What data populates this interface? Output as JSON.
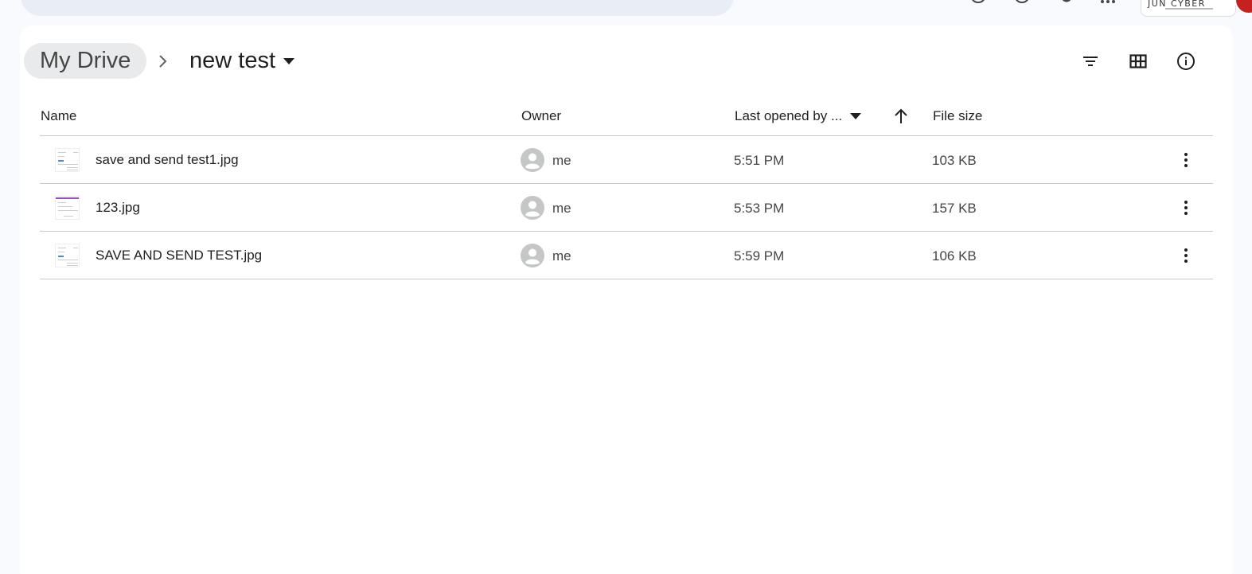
{
  "account": {
    "brand": "JUN CYBER"
  },
  "breadcrumb": {
    "root": "My Drive",
    "current": "new test"
  },
  "columns": {
    "name": "Name",
    "owner": "Owner",
    "last_opened": "Last opened by ...",
    "file_size": "File size"
  },
  "files": [
    {
      "name": "save and send test1.jpg",
      "owner": "me",
      "last_opened": "5:51 PM",
      "size": "103 KB",
      "thumb": "doc"
    },
    {
      "name": "123.jpg",
      "owner": "me",
      "last_opened": "5:53 PM",
      "size": "157 KB",
      "thumb": "purple"
    },
    {
      "name": "SAVE AND SEND TEST.jpg",
      "owner": "me",
      "last_opened": "5:59 PM",
      "size": "106 KB",
      "thumb": "doc"
    }
  ],
  "colors": {
    "background": "#f8fafd",
    "panel": "#ffffff",
    "breadcrumb_chip": "#e9eaeb",
    "divider": "#c4c7c5",
    "avatar_placeholder": "#c4c7c5",
    "account_avatar": "#c5221f"
  },
  "icons": {
    "search": "search-icon",
    "filter": "filter-icon",
    "grid": "grid-view-icon",
    "info": "info-icon",
    "sort": "arrow-up-icon",
    "more": "more-vert-icon"
  }
}
